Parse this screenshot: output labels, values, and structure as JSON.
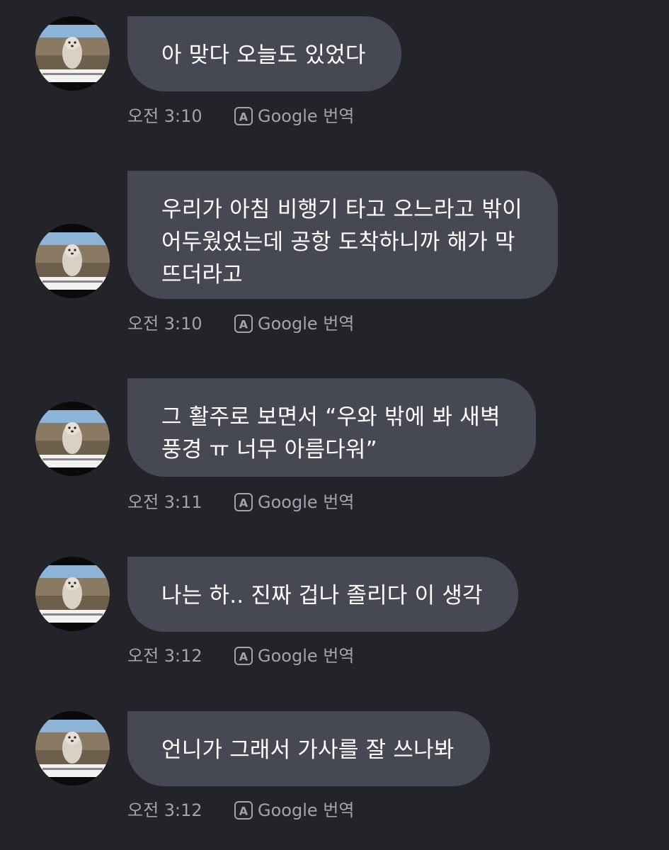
{
  "translate_label": "Google 번역",
  "messages": [
    {
      "lines": [
        "아 맞다 오늘도 있었다"
      ],
      "time": "오전 3:10"
    },
    {
      "lines": [
        "우리가 아침 비행기 타고 오느라고 밖이",
        "어두웠었는데 공항 도착하니까 해가 막",
        "뜨더라고"
      ],
      "time": "오전 3:10"
    },
    {
      "lines": [
        "그 활주로 보면서 “우와 밖에 봐 새벽",
        "풍경 ㅠ 너무 아름다워”"
      ],
      "time": "오전 3:11"
    },
    {
      "lines": [
        "나는 하.. 진짜 겁나 졸리다 이 생각"
      ],
      "time": "오전 3:12"
    },
    {
      "lines": [
        "언니가 그래서 가사를 잘 쓰나봐"
      ],
      "time": "오전 3:12"
    }
  ],
  "colors": {
    "background": "#232429",
    "bubble": "#464953",
    "meta_text": "#a2a4ab"
  },
  "icons": {
    "avatar": "dog-photo-avatar",
    "translate": "translate-a-icon"
  }
}
